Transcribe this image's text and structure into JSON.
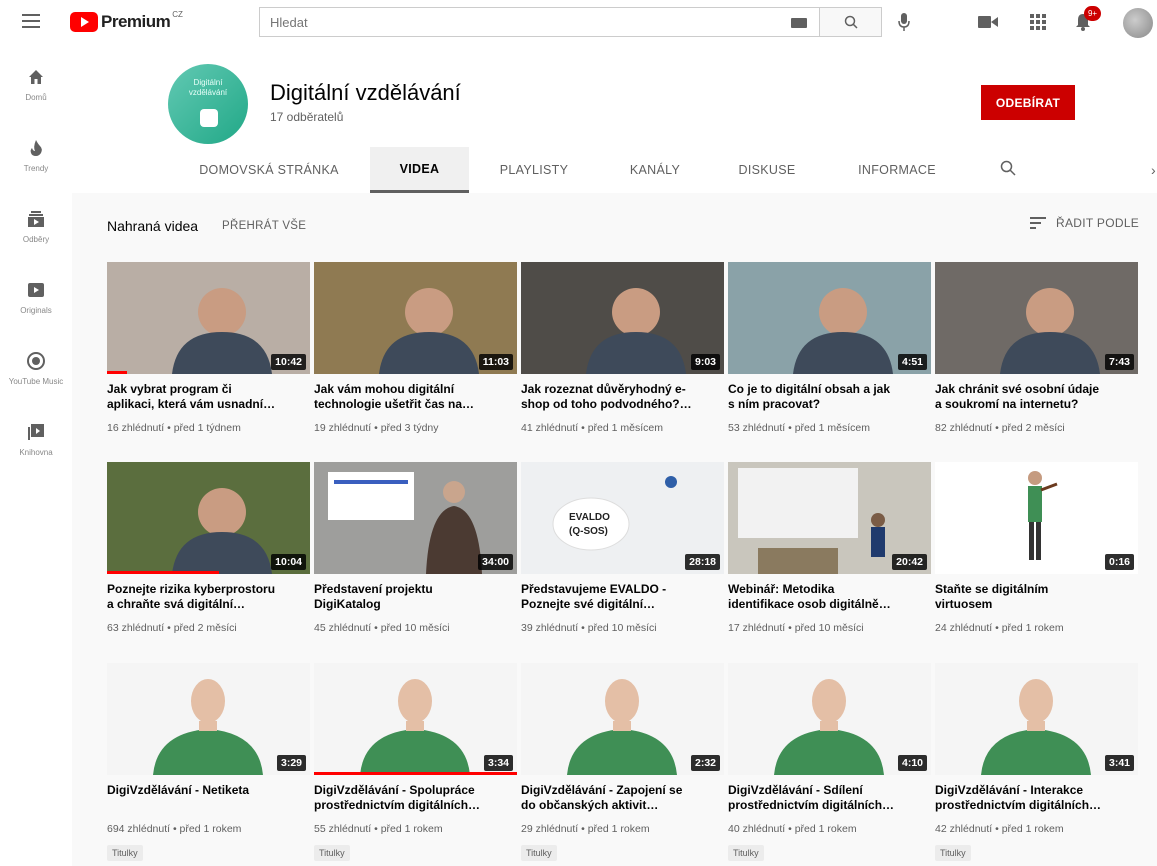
{
  "topbar": {
    "logo_text": "Premium",
    "logo_region": "CZ",
    "search_placeholder": "Hledat",
    "notification_count": "9+"
  },
  "sidebar": {
    "items": [
      {
        "label": "Domů",
        "icon": "home-icon"
      },
      {
        "label": "Trendy",
        "icon": "flame-icon"
      },
      {
        "label": "Odběry",
        "icon": "subscriptions-icon"
      },
      {
        "label": "Originals",
        "icon": "originals-icon"
      },
      {
        "label": "YouTube Music",
        "icon": "music-icon"
      },
      {
        "label": "Knihovna",
        "icon": "library-icon"
      }
    ]
  },
  "channel": {
    "avatar_text": "Digitální vzdělávání",
    "name": "Digitální vzdělávání",
    "subscribers": "17 odběratelů",
    "subscribe_label": "ODEBÍRAT"
  },
  "tabs": [
    {
      "label": "DOMOVSKÁ STRÁNKA",
      "active": false
    },
    {
      "label": "VIDEA",
      "active": true
    },
    {
      "label": "PLAYLISTY",
      "active": false
    },
    {
      "label": "KANÁLY",
      "active": false
    },
    {
      "label": "DISKUSE",
      "active": false
    },
    {
      "label": "INFORMACE",
      "active": false
    }
  ],
  "section": {
    "title": "Nahraná videa",
    "play_all": "PŘEHRÁT VŠE",
    "sort_label": "ŘADIT PODLE"
  },
  "videos": [
    {
      "title": "Jak vybrat program či\naplikaci, která vám usnadní…",
      "duration": "10:42",
      "meta": "16 zhlédnutí • před 1 týdnem",
      "progress": 0.1,
      "badge": "",
      "bg": "#b9aea5"
    },
    {
      "title": "Jak vám mohou digitální\ntechnologie ušetřit čas na…",
      "duration": "11:03",
      "meta": "19 zhlédnutí • před 3 týdny",
      "progress": 0,
      "badge": "",
      "bg": "#8f7a52"
    },
    {
      "title": "Jak rozeznat důvěryhodný e-\nshop od toho podvodného?…",
      "duration": "9:03",
      "meta": "41 zhlédnutí • před 1 měsícem",
      "progress": 0,
      "badge": "",
      "bg": "#4f4c48"
    },
    {
      "title": "Co je to digitální obsah a jak\ns ním pracovat?",
      "duration": "4:51",
      "meta": "53 zhlédnutí • před 1 měsícem",
      "progress": 0,
      "badge": "",
      "bg": "#8aa2a8"
    },
    {
      "title": "Jak chránit své osobní údaje\na soukromí na internetu?",
      "duration": "7:43",
      "meta": "82 zhlédnutí • před 2 měsíci",
      "progress": 0,
      "badge": "",
      "bg": "#6f6a66"
    },
    {
      "title": "Poznejte rizika kyberprostoru\na chraňte svá digitální…",
      "duration": "10:04",
      "meta": "63 zhlédnutí • před 2 měsíci",
      "progress": 0.55,
      "badge": "",
      "bg": "#5b6e3e"
    },
    {
      "title": "Představení projektu\nDigiKatalog",
      "duration": "34:00",
      "meta": "45 zhlédnutí • před 10 měsíci",
      "progress": 0,
      "badge": "",
      "bg": "#9e9e9c"
    },
    {
      "title": "Představujeme EVALDO -\nPoznejte své digitální…",
      "duration": "28:18",
      "meta": "39 zhlédnutí • před 10 měsíci",
      "progress": 0,
      "badge": "",
      "bg": "#eef0f2"
    },
    {
      "title": "Webinář: Metodika\nidentifikace osob digitálně…",
      "duration": "20:42",
      "meta": "17 zhlédnutí • před 10 měsíci",
      "progress": 0,
      "badge": "",
      "bg": "#c9c6bd"
    },
    {
      "title": "Staňte se digitálním\nvirtuosem",
      "duration": "0:16",
      "meta": "24 zhlédnutí • před 1 rokem",
      "progress": 0,
      "badge": "",
      "bg": "#ffffff"
    },
    {
      "title": "DigiVzdělávání - Netiketa",
      "duration": "3:29",
      "meta": "694 zhlédnutí • před 1 rokem",
      "progress": 0,
      "badge": "Titulky",
      "bg": "#f5f5f5"
    },
    {
      "title": "DigiVzdělávání - Spolupráce\nprostřednictvím digitálních…",
      "duration": "3:34",
      "meta": "55 zhlédnutí • před 1 rokem",
      "progress": 1.0,
      "badge": "Titulky",
      "bg": "#f5f5f5"
    },
    {
      "title": "DigiVzdělávání - Zapojení se\ndo občanských aktivit…",
      "duration": "2:32",
      "meta": "29 zhlédnutí • před 1 rokem",
      "progress": 0,
      "badge": "Titulky",
      "bg": "#f5f5f5"
    },
    {
      "title": "DigiVzdělávání - Sdílení\nprostřednictvím digitálních…",
      "duration": "4:10",
      "meta": "40 zhlédnutí • před 1 rokem",
      "progress": 0,
      "badge": "Titulky",
      "bg": "#f5f5f5"
    },
    {
      "title": "DigiVzdělávání - Interakce\nprostřednictvím digitálních…",
      "duration": "3:41",
      "meta": "42 zhlédnutí • před 1 rokem",
      "progress": 0,
      "badge": "Titulky",
      "bg": "#f5f5f5"
    }
  ],
  "colors": {
    "accent": "#ff0000",
    "subscribe": "#cc0000",
    "shirt": "#3f8f55"
  }
}
